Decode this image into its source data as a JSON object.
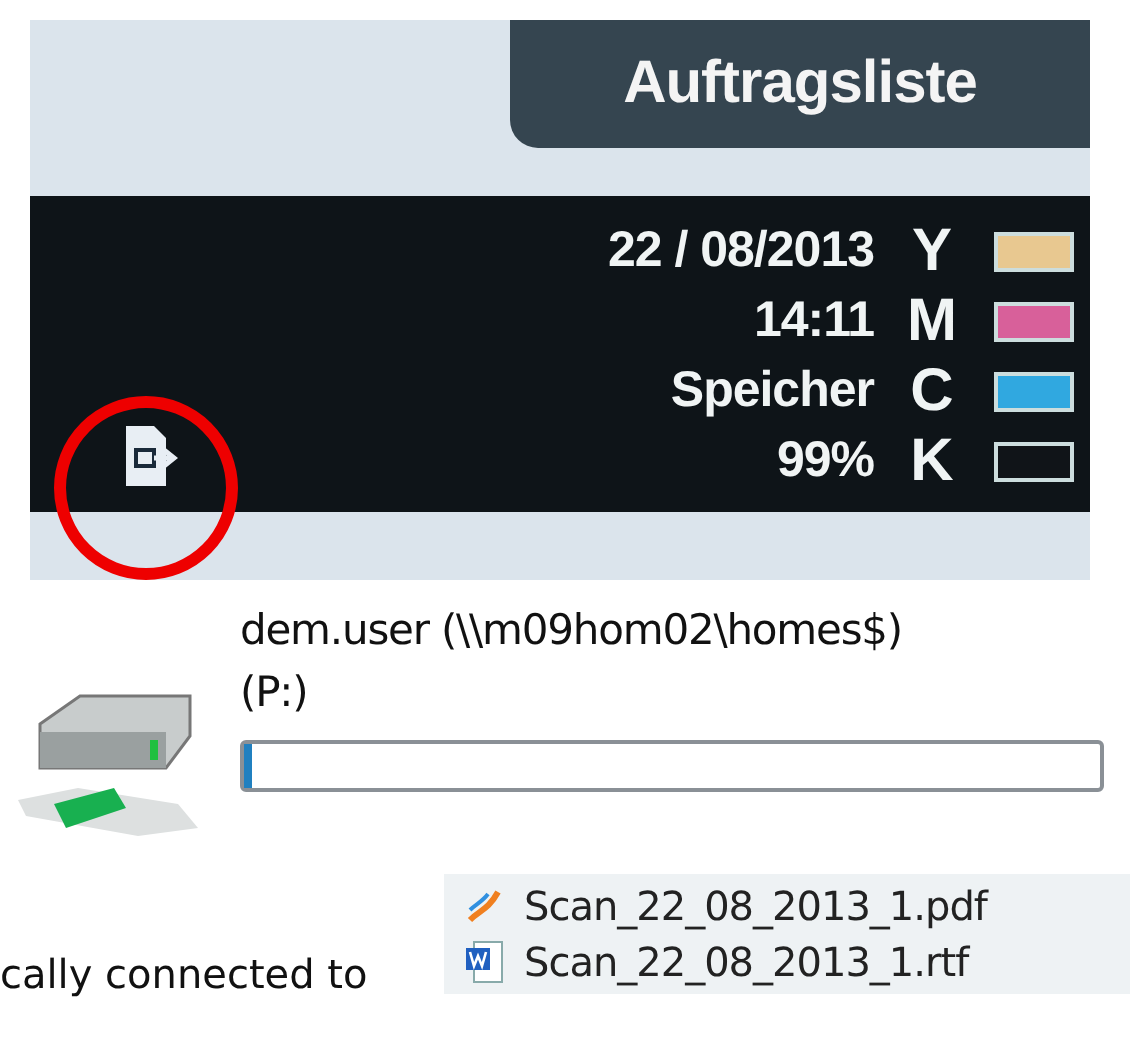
{
  "printer_display": {
    "tab": "Auftragsliste",
    "date": "22 / 08/2013",
    "time": "14:11",
    "memory_label": "Speicher",
    "memory_value": "99%",
    "inks": [
      {
        "letter": "Y",
        "color": "#e8c890"
      },
      {
        "letter": "M",
        "color": "#d8609a"
      },
      {
        "letter": "C",
        "color": "#30a8e0"
      },
      {
        "letter": "K",
        "color": "#101418"
      }
    ]
  },
  "drive": {
    "name": "dem.user (\\\\m09hom02\\homes$)",
    "letter": "(P:)",
    "level": 0.01
  },
  "body_text": "cally connected to",
  "files": [
    {
      "name": "Scan_22_08_2013_1.pdf",
      "kind": "pdf"
    },
    {
      "name": "Scan_22_08_2013_1.rtf",
      "kind": "rtf"
    }
  ]
}
